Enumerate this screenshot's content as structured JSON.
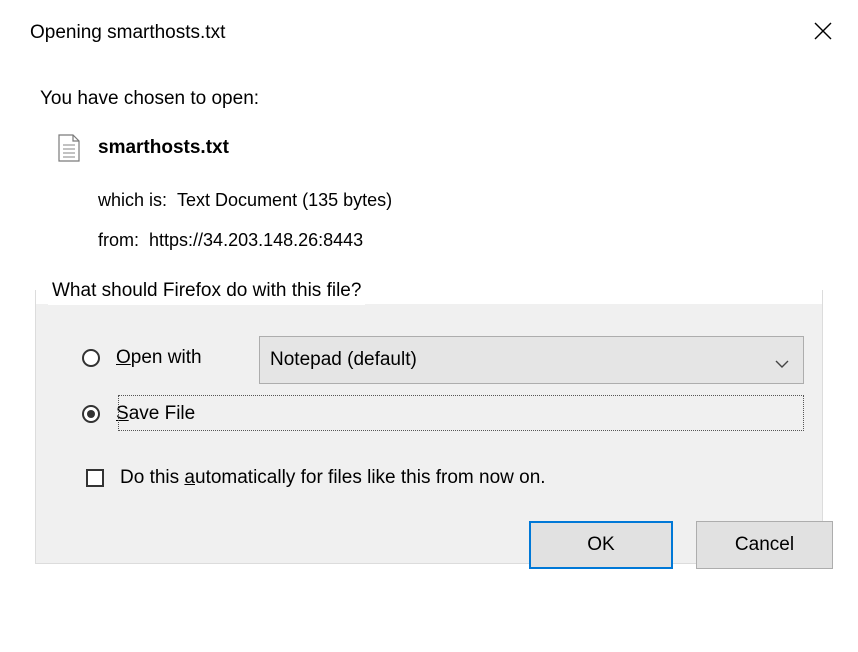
{
  "window": {
    "title": "Opening smarthosts.txt",
    "close_glyph": "✕"
  },
  "intro": "You have chosen to open:",
  "file": {
    "name": "smarthosts.txt",
    "icon": "text-file-icon",
    "which_is_label": "which is:",
    "which_is_value": "Text Document (135 bytes)",
    "from_label": "from:",
    "from_value": "https://34.203.148.26:8443"
  },
  "action_group": {
    "legend": "What should Firefox do with this file?",
    "open_with": {
      "mnemonic": "O",
      "rest": "pen with",
      "selected": false
    },
    "app_select": {
      "value": "Notepad (default)"
    },
    "save_file": {
      "mnemonic": "S",
      "rest": "ave File",
      "selected": true
    },
    "auto_checkbox": {
      "before": "Do this ",
      "mnemonic": "a",
      "after": "utomatically for files like this from now on.",
      "checked": false
    }
  },
  "buttons": {
    "ok": "OK",
    "cancel": "Cancel"
  },
  "colors": {
    "default_button_border": "#0078d7",
    "button_bg": "#e1e1e1",
    "panel_bg": "#f0f0f0"
  }
}
